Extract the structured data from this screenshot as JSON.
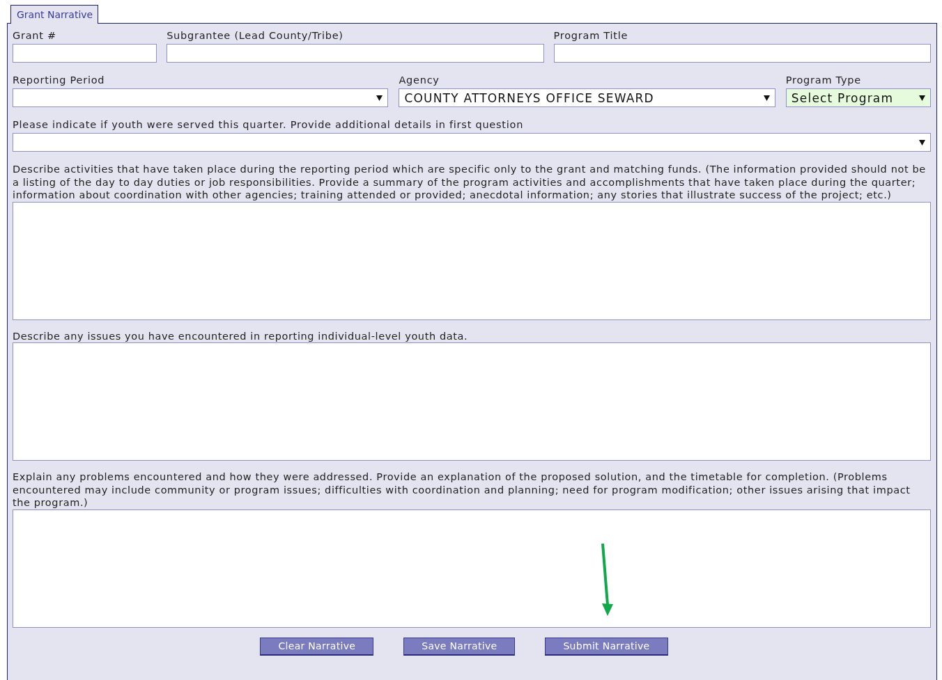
{
  "tabs": [
    {
      "label": "Grant Narrative",
      "selected": true
    }
  ],
  "rows": [
    [
      {
        "kind": "text",
        "label": "Grant #"
      },
      {
        "kind": "text",
        "label": "Subgrantee (Lead County/Tribe)"
      },
      {
        "kind": "text",
        "label": "Program Title"
      }
    ],
    [
      {
        "kind": "select",
        "label": "Reporting Period"
      },
      {
        "kind": "select",
        "label": "Agency",
        "value": "COUNTY ATTORNEYS OFFICE SEWARD"
      },
      {
        "kind": "select",
        "label": "Program Type",
        "value": "Select Program",
        "highlighted": true
      }
    ],
    [
      {
        "kind": "select",
        "label": "Please indicate if youth were served this quarter. Provide additional details in first question"
      }
    ]
  ],
  "questions": [
    {
      "prompt": "Describe activities that have taken place during the reporting period which are specific only to the grant and matching funds. (The information provided should not be a listing of the day to day duties or job responsibilities. Provide a summary of the program activities and accomplishments that have taken place during the quarter; information about coordination with other agencies; training attended or provided; anecdotal information; any stories that illustrate success of the project; etc.)"
    },
    {
      "prompt": "Describe any issues you have encountered in reporting individual-level youth data."
    },
    {
      "prompt": "Explain any problems encountered and how they were addressed. Provide an explanation of the proposed solution, and the timetable for completion. (Problems encountered may include community or program issues; difficulties with coordination and planning; need for program modification; other issues arising that impact the program.)"
    }
  ],
  "buttons": [
    "Clear Narrative",
    "Save Narrative",
    "Submit Narrative"
  ]
}
